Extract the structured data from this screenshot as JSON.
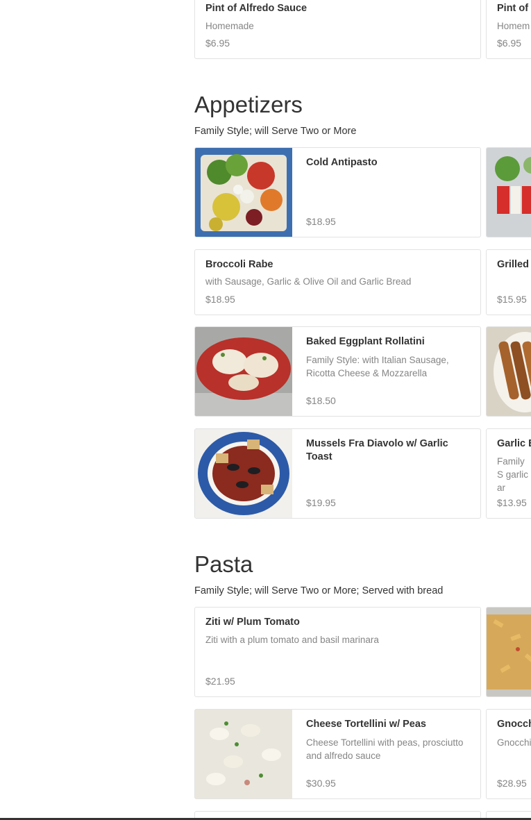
{
  "top_row": {
    "left": {
      "name": "Pint of Alfredo Sauce",
      "desc": "Homemade",
      "price": "$6.95"
    },
    "right": {
      "name": "Pint of",
      "desc": "Homem",
      "price": "$6.95"
    }
  },
  "sections": [
    {
      "title": "Appetizers",
      "subtitle": "Family Style; will Serve Two or More",
      "items": [
        {
          "name": "Cold Antipasto",
          "desc": "",
          "price": "$18.95",
          "image": "antipasto-photo"
        },
        {
          "name": "",
          "desc": "",
          "price": "",
          "image": "caprese-photo"
        },
        {
          "name": "Broccoli Rabe",
          "desc": "with Sausage, Garlic & Olive Oil and Garlic Bread",
          "price": "$18.95"
        },
        {
          "name": "Grilled",
          "desc": "",
          "price": "$15.95"
        },
        {
          "name": "Baked Eggplant Rollatini",
          "desc": "Family Style: with Italian Sausage, Ricotta Cheese & Mozzarella",
          "price": "$18.50",
          "image": "eggplant-photo"
        },
        {
          "name": "",
          "desc": "",
          "price": "",
          "image": "mozzarella-sticks-photo"
        },
        {
          "name": "Mussels Fra Diavolo w/ Garlic Toast",
          "desc": "",
          "price": "$19.95",
          "image": "mussels-photo"
        },
        {
          "name": "Garlic B",
          "desc": "Family S garlic ar",
          "price": "$13.95"
        }
      ]
    },
    {
      "title": "Pasta",
      "subtitle": "Family Style; will Serve Two or More; Served with bread",
      "items": [
        {
          "name": "Ziti w/ Plum Tomato",
          "desc": "Ziti with a plum tomato and basil marinara",
          "price": "$21.95"
        },
        {
          "name": "",
          "desc": "",
          "price": "",
          "image": "penne-photo"
        },
        {
          "name": "Cheese Tortellini w/ Peas",
          "desc": "Cheese Tortellini with peas, prosciutto and alfredo sauce",
          "price": "$30.95",
          "image": "tortellini-photo"
        },
        {
          "name": "Gnocch",
          "desc": "Gnocchi",
          "price": "$28.95"
        }
      ]
    }
  ],
  "colors": {
    "text": "#333333",
    "muted": "#858585",
    "border": "#e2e2e2"
  }
}
